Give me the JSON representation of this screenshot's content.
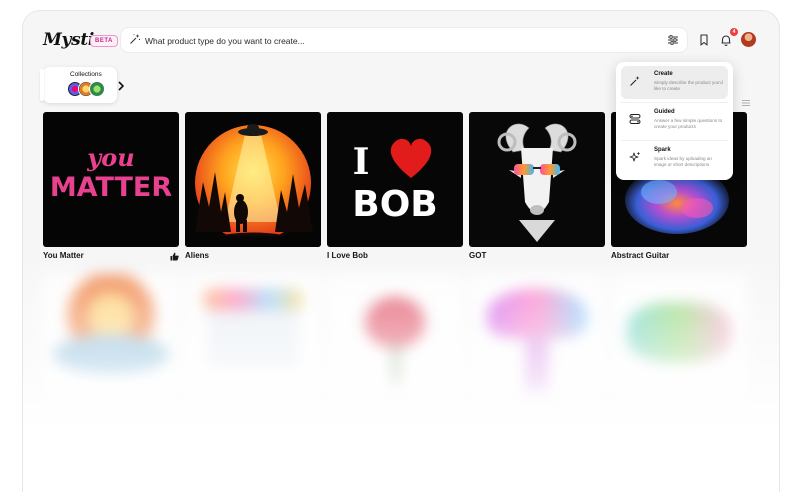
{
  "app": {
    "logo": "Mystic",
    "badge": "BETA"
  },
  "search": {
    "placeholder": "What product type do you want to create..."
  },
  "header": {
    "notification_count": "4"
  },
  "collections": {
    "title": "Collections"
  },
  "dropdown": {
    "items": [
      {
        "title": "Create",
        "desc": "Simply describe the product you'd like to create",
        "icon": "magic-wand-icon"
      },
      {
        "title": "Guided",
        "desc": "Answer a few simple questions to create your products",
        "icon": "route-icon"
      },
      {
        "title": "Spark",
        "desc": "Spark ideas by uploading an image or short descriptions",
        "icon": "sparkle-icon"
      }
    ]
  },
  "designs": [
    {
      "title": "You Matter",
      "art_line1": "you",
      "art_line2": "MATTER"
    },
    {
      "title": "Aliens"
    },
    {
      "title": "I Love Bob",
      "art_line1": "I",
      "art_line2": "BOB"
    },
    {
      "title": "GOT"
    },
    {
      "title": "Abstract Guitar"
    }
  ],
  "colors": {
    "accent_pink": "#e8418f",
    "heart_red": "#e21b1b",
    "badge_red": "#ef3d3d"
  }
}
